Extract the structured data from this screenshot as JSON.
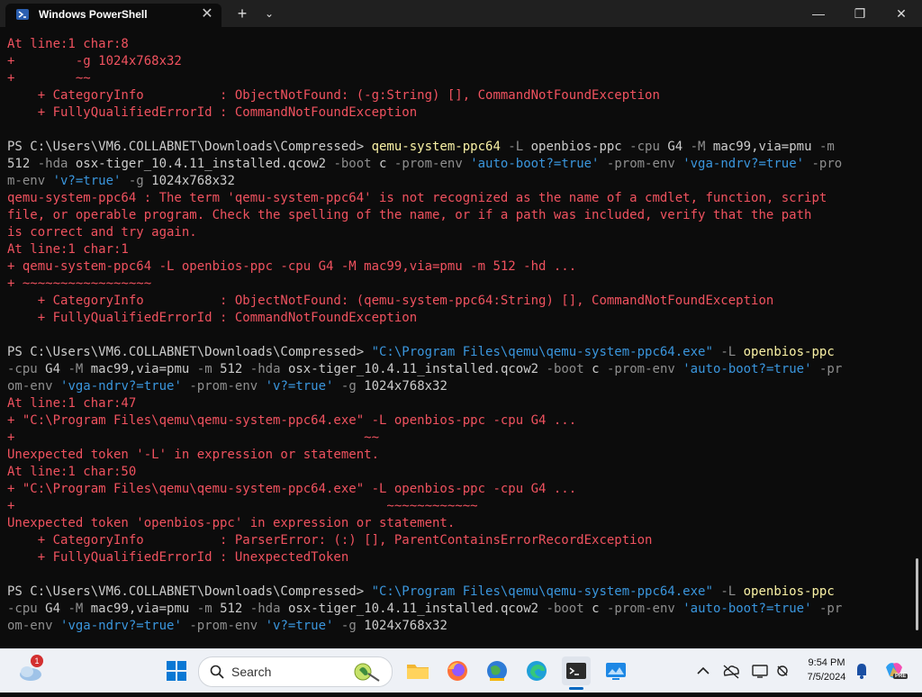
{
  "window": {
    "tab_title": "Windows PowerShell",
    "close_tab": "✕",
    "new_tab": "+",
    "dropdown": "⌄",
    "minimize": "—",
    "maximize": "❐",
    "close": "✕"
  },
  "terminal": {
    "lines": [
      [
        {
          "t": "At line:1 char:8",
          "c": "r"
        }
      ],
      [
        {
          "t": "+        -g 1024x768x32",
          "c": "r"
        }
      ],
      [
        {
          "t": "+        ~~",
          "c": "r"
        }
      ],
      [
        {
          "t": "    + CategoryInfo          : ObjectNotFound: (-g:String) [], CommandNotFoundException",
          "c": "r"
        }
      ],
      [
        {
          "t": "    + FullyQualifiedErrorId : CommandNotFoundException",
          "c": "r"
        }
      ],
      [
        {
          "t": " ",
          "c": "w"
        }
      ],
      [
        {
          "t": "PS C:\\Users\\VM6.COLLABNET\\Downloads\\Compressed> ",
          "c": "w"
        },
        {
          "t": "qemu-system-ppc64",
          "c": "y"
        },
        {
          "t": " -L ",
          "c": "g"
        },
        {
          "t": "openbios-ppc ",
          "c": "w"
        },
        {
          "t": "-cpu ",
          "c": "g"
        },
        {
          "t": "G4 ",
          "c": "w"
        },
        {
          "t": "-M ",
          "c": "g"
        },
        {
          "t": "mac99,via=pmu ",
          "c": "w"
        },
        {
          "t": "-m",
          "c": "g"
        }
      ],
      [
        {
          "t": "512 ",
          "c": "w"
        },
        {
          "t": "-hda ",
          "c": "g"
        },
        {
          "t": "osx-tiger_10.4.11_installed.qcow2 ",
          "c": "w"
        },
        {
          "t": "-boot ",
          "c": "g"
        },
        {
          "t": "c ",
          "c": "w"
        },
        {
          "t": "-prom-env ",
          "c": "g"
        },
        {
          "t": "'auto-boot?=true' ",
          "c": "c"
        },
        {
          "t": "-prom-env ",
          "c": "g"
        },
        {
          "t": "'vga-ndrv?=true' ",
          "c": "c"
        },
        {
          "t": "-pro",
          "c": "g"
        }
      ],
      [
        {
          "t": "m-env ",
          "c": "g"
        },
        {
          "t": "'v?=true' ",
          "c": "c"
        },
        {
          "t": "-g ",
          "c": "g"
        },
        {
          "t": "1024x768x32",
          "c": "w"
        }
      ],
      [
        {
          "t": "qemu-system-ppc64 : The term 'qemu-system-ppc64' is not recognized as the name of a cmdlet, function, script",
          "c": "r"
        }
      ],
      [
        {
          "t": "file, or operable program. Check the spelling of the name, or if a path was included, verify that the path",
          "c": "r"
        }
      ],
      [
        {
          "t": "is correct and try again.",
          "c": "r"
        }
      ],
      [
        {
          "t": "At line:1 char:1",
          "c": "r"
        }
      ],
      [
        {
          "t": "+ qemu-system-ppc64 -L openbios-ppc -cpu G4 -M mac99,via=pmu -m 512 -hd ...",
          "c": "r"
        }
      ],
      [
        {
          "t": "+ ~~~~~~~~~~~~~~~~~",
          "c": "r"
        }
      ],
      [
        {
          "t": "    + CategoryInfo          : ObjectNotFound: (qemu-system-ppc64:String) [], CommandNotFoundException",
          "c": "r"
        }
      ],
      [
        {
          "t": "    + FullyQualifiedErrorId : CommandNotFoundException",
          "c": "r"
        }
      ],
      [
        {
          "t": " ",
          "c": "w"
        }
      ],
      [
        {
          "t": "PS C:\\Users\\VM6.COLLABNET\\Downloads\\Compressed> ",
          "c": "w"
        },
        {
          "t": "\"C:\\Program Files\\qemu\\qemu-system-ppc64.exe\" ",
          "c": "c"
        },
        {
          "t": "-L ",
          "c": "g"
        },
        {
          "t": "openbios-ppc",
          "c": "y"
        }
      ],
      [
        {
          "t": "-cpu ",
          "c": "g"
        },
        {
          "t": "G4 ",
          "c": "w"
        },
        {
          "t": "-M ",
          "c": "g"
        },
        {
          "t": "mac99,via=pmu ",
          "c": "w"
        },
        {
          "t": "-m ",
          "c": "g"
        },
        {
          "t": "512 ",
          "c": "w"
        },
        {
          "t": "-hda ",
          "c": "g"
        },
        {
          "t": "osx-tiger_10.4.11_installed.qcow2 ",
          "c": "w"
        },
        {
          "t": "-boot ",
          "c": "g"
        },
        {
          "t": "c ",
          "c": "w"
        },
        {
          "t": "-prom-env ",
          "c": "g"
        },
        {
          "t": "'auto-boot?=true' ",
          "c": "c"
        },
        {
          "t": "-pr",
          "c": "g"
        }
      ],
      [
        {
          "t": "om-env ",
          "c": "g"
        },
        {
          "t": "'vga-ndrv?=true' ",
          "c": "c"
        },
        {
          "t": "-prom-env ",
          "c": "g"
        },
        {
          "t": "'v?=true' ",
          "c": "c"
        },
        {
          "t": "-g ",
          "c": "g"
        },
        {
          "t": "1024x768x32",
          "c": "w"
        }
      ],
      [
        {
          "t": "At line:1 char:47",
          "c": "r"
        }
      ],
      [
        {
          "t": "+ \"C:\\Program Files\\qemu\\qemu-system-ppc64.exe\" -L openbios-ppc -cpu G4 ...",
          "c": "r"
        }
      ],
      [
        {
          "t": "+                                              ~~",
          "c": "r"
        }
      ],
      [
        {
          "t": "Unexpected token '-L' in expression or statement.",
          "c": "r"
        }
      ],
      [
        {
          "t": "At line:1 char:50",
          "c": "r"
        }
      ],
      [
        {
          "t": "+ \"C:\\Program Files\\qemu\\qemu-system-ppc64.exe\" -L openbios-ppc -cpu G4 ...",
          "c": "r"
        }
      ],
      [
        {
          "t": "+                                                 ~~~~~~~~~~~~",
          "c": "r"
        }
      ],
      [
        {
          "t": "Unexpected token 'openbios-ppc' in expression or statement.",
          "c": "r"
        }
      ],
      [
        {
          "t": "    + CategoryInfo          : ParserError: (:) [], ParentContainsErrorRecordException",
          "c": "r"
        }
      ],
      [
        {
          "t": "    + FullyQualifiedErrorId : UnexpectedToken",
          "c": "r"
        }
      ],
      [
        {
          "t": " ",
          "c": "w"
        }
      ],
      [
        {
          "t": "PS C:\\Users\\VM6.COLLABNET\\Downloads\\Compressed> ",
          "c": "w"
        },
        {
          "t": "\"C:\\Program Files\\qemu\\qemu-system-ppc64.exe\" ",
          "c": "c"
        },
        {
          "t": "-L ",
          "c": "g"
        },
        {
          "t": "openbios-ppc",
          "c": "y"
        }
      ],
      [
        {
          "t": "-cpu ",
          "c": "g"
        },
        {
          "t": "G4 ",
          "c": "w"
        },
        {
          "t": "-M ",
          "c": "g"
        },
        {
          "t": "mac99,via=pmu ",
          "c": "w"
        },
        {
          "t": "-m ",
          "c": "g"
        },
        {
          "t": "512 ",
          "c": "w"
        },
        {
          "t": "-hda ",
          "c": "g"
        },
        {
          "t": "osx-tiger_10.4.11_installed.qcow2 ",
          "c": "w"
        },
        {
          "t": "-boot ",
          "c": "g"
        },
        {
          "t": "c ",
          "c": "w"
        },
        {
          "t": "-prom-env ",
          "c": "g"
        },
        {
          "t": "'auto-boot?=true' ",
          "c": "c"
        },
        {
          "t": "-pr",
          "c": "g"
        }
      ],
      [
        {
          "t": "om-env ",
          "c": "g"
        },
        {
          "t": "'vga-ndrv?=true' ",
          "c": "c"
        },
        {
          "t": "-prom-env ",
          "c": "g"
        },
        {
          "t": "'v?=true' ",
          "c": "c"
        },
        {
          "t": "-g ",
          "c": "g"
        },
        {
          "t": "1024x768x32",
          "c": "w"
        }
      ]
    ]
  },
  "taskbar": {
    "weather_badge": "1",
    "search_placeholder": "Search",
    "apps": [
      "file-explorer-icon",
      "firefox-icon",
      "network-globe-icon",
      "edge-icon",
      "terminal-icon",
      "monitor-app-icon"
    ],
    "clock_time": "9:54 PM",
    "clock_date": "7/5/2024",
    "copilot_badge": "PRE"
  }
}
